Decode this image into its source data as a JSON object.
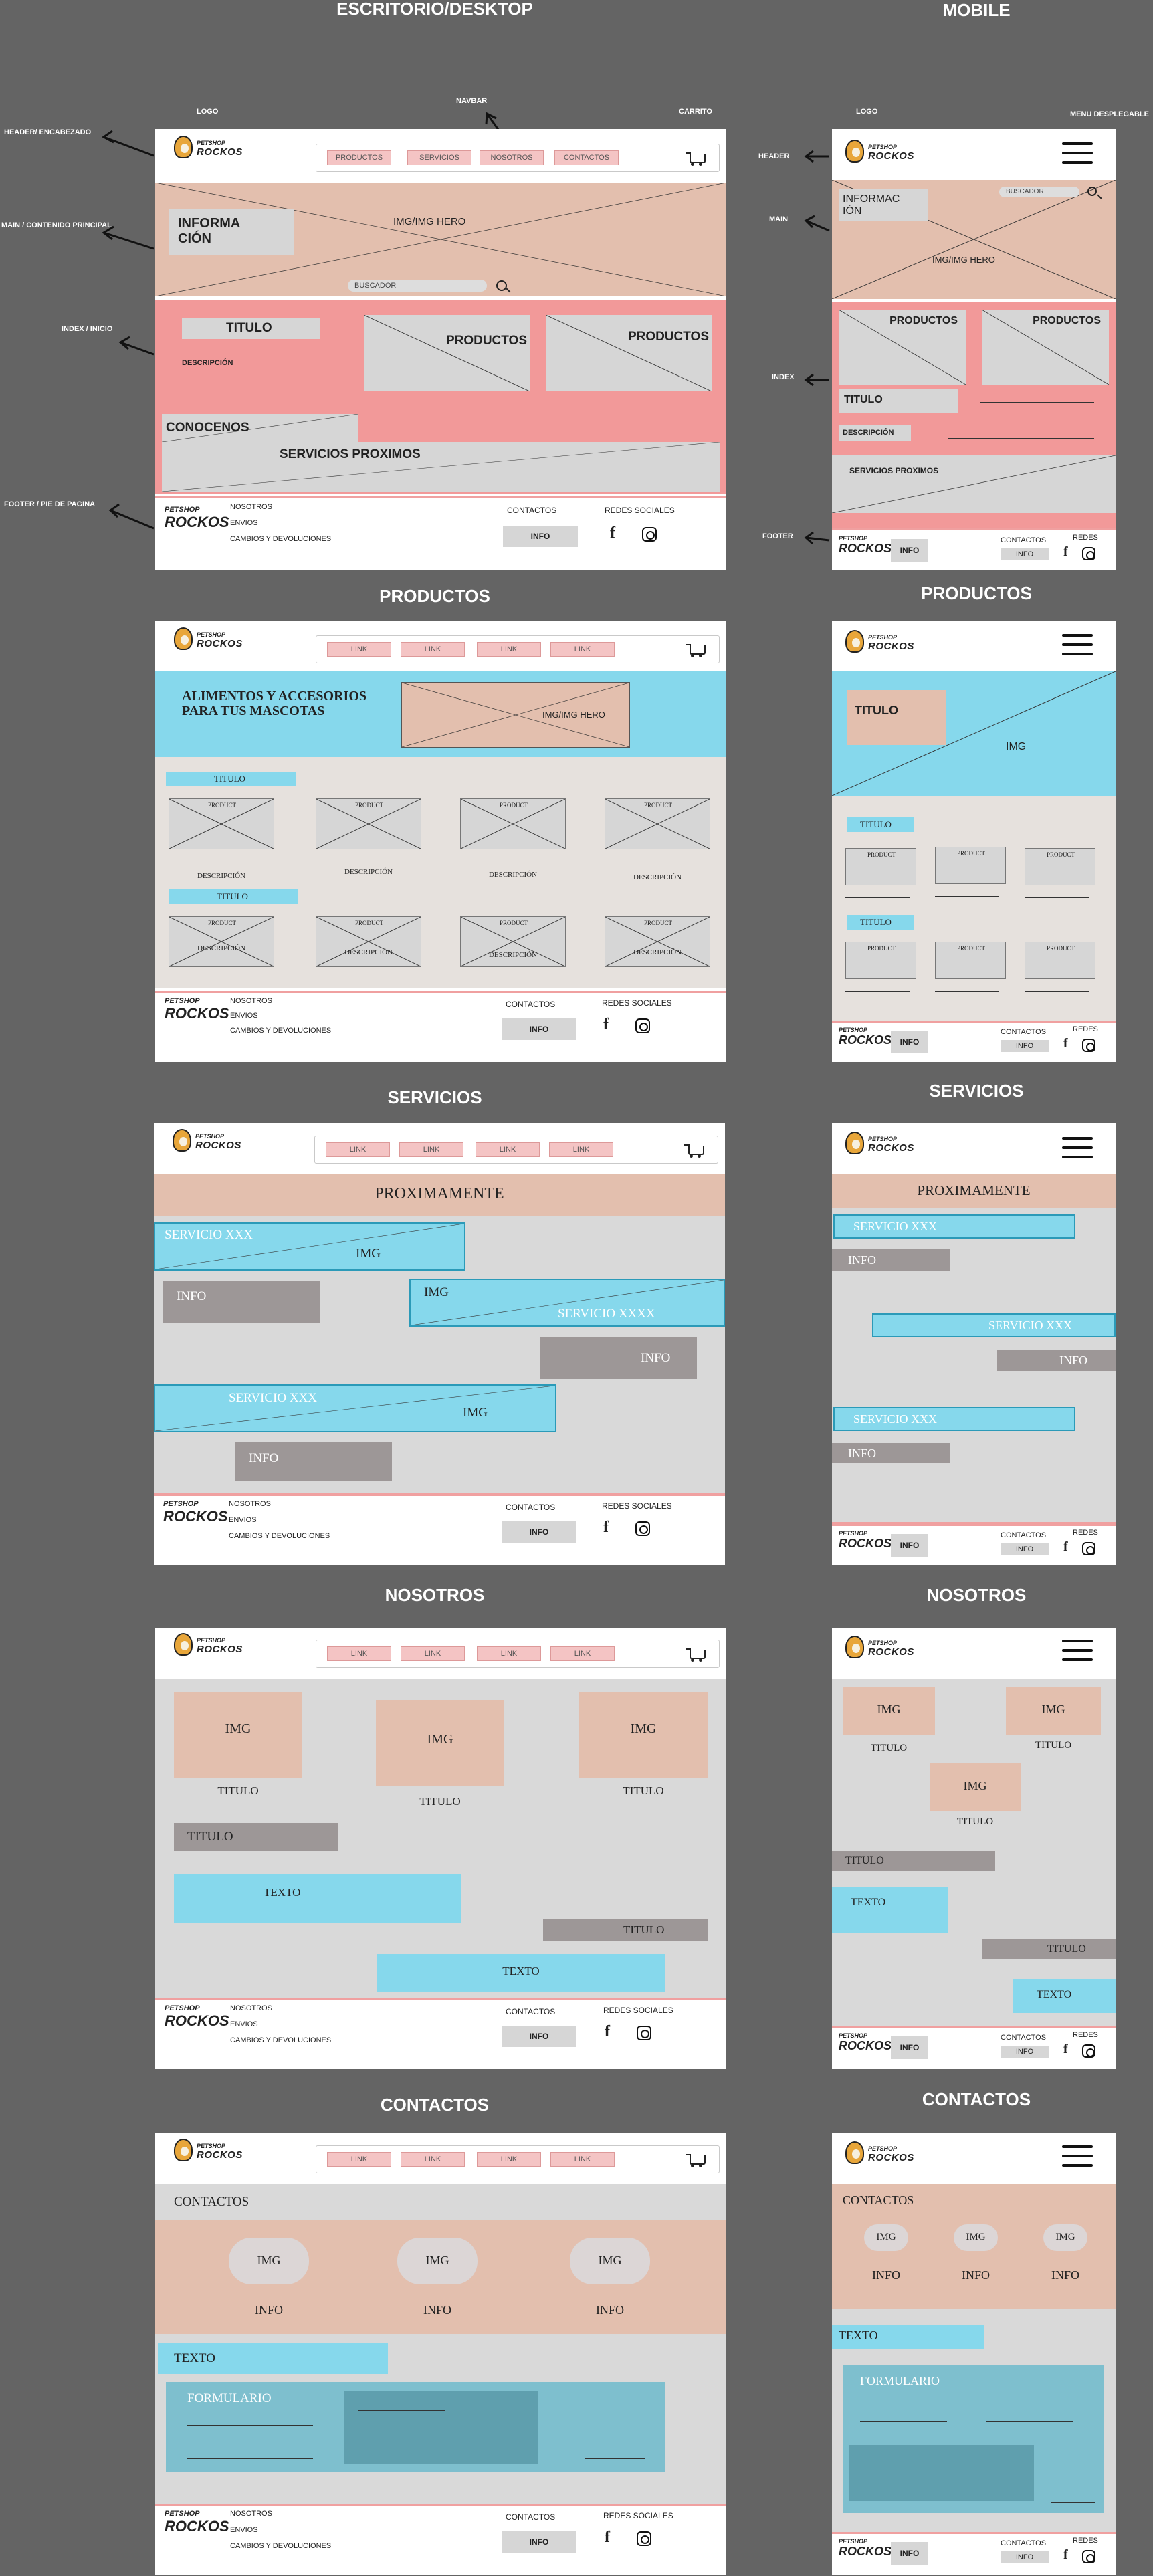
{
  "columns": {
    "desktop": "ESCRITORIO/DESKTOP",
    "mobile": "MOBILE"
  },
  "annotations": {
    "desktop_logo": "LOGO",
    "navbar": "NAVBAR",
    "carrito": "CARRITO",
    "header": "HEADER/ ENCABEZADO",
    "main": "MAIN / CONTENIDO PRINCIPAL",
    "index": "INDEX / INICIO",
    "footer": "FOOTER / PIE DE PAGINA",
    "mobile_logo": "LOGO",
    "menu": "MENU DESPLEGABLE",
    "m_header": "HEADER",
    "m_main": "MAIN",
    "m_index": "INDEX",
    "m_footer": "FOOTER"
  },
  "brand": {
    "line1": "PETSHOP",
    "line2": "ROCKOS"
  },
  "nav_home": [
    "PRODUCTOS",
    "SERVICIOS",
    "NOSOTROS",
    "CONTACTOS"
  ],
  "nav_link": "LINK",
  "footer": {
    "links": [
      "NOSOTROS",
      "ENVIOS",
      "CAMBIOS Y DEVOLUCIONES"
    ],
    "contactos": "CONTACTOS",
    "redes": "REDES SOCIALES",
    "redes_short": "REDES",
    "info": "INFO"
  },
  "home": {
    "informacion": "INFORMA CIÓN",
    "m_informacion": "INFORMAC IÓN",
    "hero": "IMG/IMG HERO",
    "buscador": "BUSCADOR",
    "titulo": "TITULO",
    "descripcion": "DESCRIPCIÓN",
    "productos": "PRODUCTOS",
    "conocenos": "CONOCENOS",
    "servicios": "SERVICIOS  PROXIMOS",
    "m_servicios": "SERVICIOS  PROXIMOS"
  },
  "section_titles": {
    "productos": "PRODUCTOS",
    "servicios": "SERVICIOS",
    "nosotros": "NOSOTROS",
    "contactos": "CONTACTOS"
  },
  "productos": {
    "banner": "ALIMENTOS Y ACCESORIOS PARA TUS MASCOTAS",
    "hero": "IMG/IMG HERO",
    "titulo": "TITULO",
    "product": "PRODUCT",
    "descripcion": "DESCRIPCIÓN",
    "m_titulo": "TITULO",
    "m_img": "IMG"
  },
  "servicios": {
    "proximamente": "PROXIMAMENTE",
    "servicio": "SERVICIO XXX",
    "servicio2": "SERVICIO  XXXX",
    "img": "IMG",
    "info": "INFO"
  },
  "nosotros": {
    "img": "IMG",
    "titulo": "TITULO",
    "texto": "TEXTO"
  },
  "contactos": {
    "contactos": "CONTACTOS",
    "img": "IMG",
    "info": "INFO",
    "texto": "TEXTO",
    "formulario": "FORMULARIO"
  }
}
